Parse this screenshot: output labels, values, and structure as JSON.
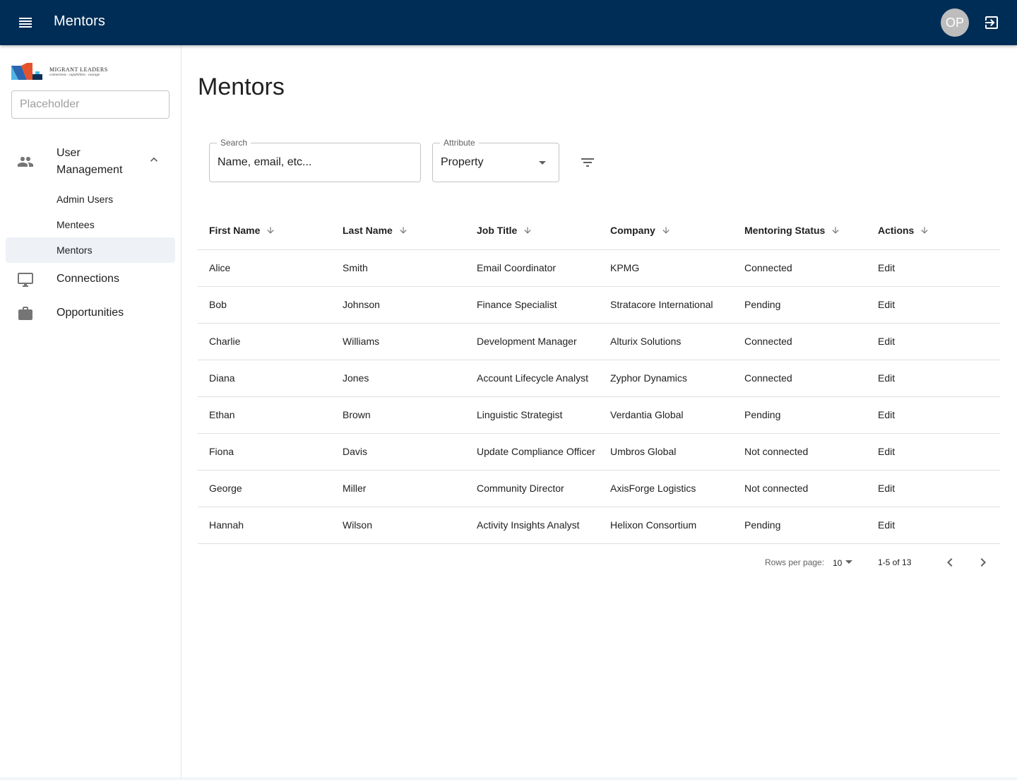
{
  "appbar": {
    "title": "Mentors",
    "avatar_initials": "OP",
    "icons": {
      "menu": "menu-icon",
      "logout": "logout-icon"
    },
    "background": "#002d55"
  },
  "sidebar": {
    "logo": {
      "name": "MIGRANT LEADERS",
      "tagline": "connections · capabilities · courage"
    },
    "search_placeholder": "Placeholder",
    "group": {
      "label": "User Management",
      "icon": "people-icon",
      "expanded": true,
      "items": [
        {
          "label": "Admin Users",
          "active": false
        },
        {
          "label": "Mentees",
          "active": false
        },
        {
          "label": "Mentors",
          "active": true
        }
      ]
    },
    "items": [
      {
        "label": "Connections",
        "icon": "monitor-icon"
      },
      {
        "label": "Opportunities",
        "icon": "briefcase-icon"
      }
    ]
  },
  "main": {
    "title": "Mentors",
    "search": {
      "label": "Search",
      "placeholder": "Name, email, etc..."
    },
    "attribute": {
      "label": "Attribute",
      "value": "Property"
    },
    "table": {
      "columns": [
        "First Name",
        "Last Name",
        "Job Title",
        "Company",
        "Mentoring Status",
        "Actions"
      ],
      "rows": [
        [
          "Alice",
          "Smith",
          "Email Coordinator",
          "KPMG",
          "Connected",
          "Edit"
        ],
        [
          "Bob",
          "Johnson",
          "Finance Specialist",
          "Stratacore International",
          "Pending",
          "Edit"
        ],
        [
          "Charlie",
          "Williams",
          "Development Manager",
          "Alturix Solutions",
          "Connected",
          "Edit"
        ],
        [
          "Diana",
          "Jones",
          "Account Lifecycle Analyst",
          "Zyphor Dynamics",
          "Connected",
          "Edit"
        ],
        [
          "Ethan",
          "Brown",
          "Linguistic Strategist",
          "Verdantia Global",
          "Pending",
          "Edit"
        ],
        [
          "Fiona",
          "Davis",
          "Update Compliance Officer",
          "Umbros Global",
          "Not connected",
          "Edit"
        ],
        [
          "George",
          "Miller",
          "Community Director",
          "AxisForge Logistics",
          "Not connected",
          "Edit"
        ],
        [
          "Hannah",
          "Wilson",
          "Activity Insights Analyst",
          "Helixon Consortium",
          "Pending",
          "Edit"
        ]
      ]
    },
    "pagination": {
      "rows_per_page_label": "Rows per page:",
      "rows_per_page": "10",
      "range": "1-5 of 13"
    }
  }
}
